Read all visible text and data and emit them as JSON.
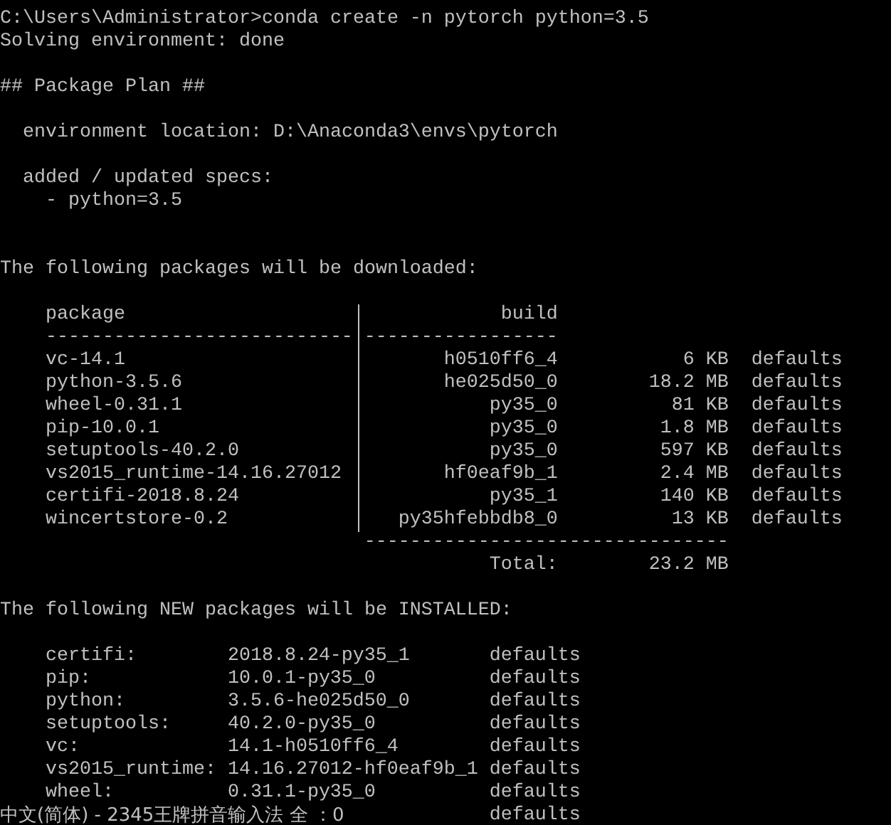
{
  "terminal": {
    "blocks": [
      {
        "kind": "text",
        "lines": [
          "C:\\Users\\Administrator>conda create -n pytorch python=3.5",
          "Solving environment: done"
        ]
      },
      {
        "kind": "blank"
      },
      {
        "kind": "text",
        "lines": [
          "## Package Plan ##"
        ]
      },
      {
        "kind": "blank"
      },
      {
        "kind": "text",
        "lines": [
          "  environment location: D:\\Anaconda3\\envs\\pytorch"
        ]
      },
      {
        "kind": "blank"
      },
      {
        "kind": "text",
        "lines": [
          "  added / updated specs:",
          "    - python=3.5"
        ]
      },
      {
        "kind": "blank"
      },
      {
        "kind": "blank"
      },
      {
        "kind": "text",
        "lines": [
          "The following packages will be downloaded:"
        ]
      },
      {
        "kind": "blank"
      },
      {
        "kind": "download_table",
        "columns": [
          "package",
          "build"
        ],
        "rule_left": "---------------------------",
        "rule_right": "-----------------",
        "rows": [
          {
            "package": "vc-14.1",
            "build": "h0510ff6_4",
            "size": "6 KB",
            "channel": "defaults"
          },
          {
            "package": "python-3.5.6",
            "build": "he025d50_0",
            "size": "18.2 MB",
            "channel": "defaults"
          },
          {
            "package": "wheel-0.31.1",
            "build": "py35_0",
            "size": "81 KB",
            "channel": "defaults"
          },
          {
            "package": "pip-10.0.1",
            "build": "py35_0",
            "size": "1.8 MB",
            "channel": "defaults"
          },
          {
            "package": "setuptools-40.2.0",
            "build": "py35_0",
            "size": "597 KB",
            "channel": "defaults"
          },
          {
            "package": "vs2015_runtime-14.16.27012",
            "build": "hf0eaf9b_1",
            "size": "2.4 MB",
            "channel": "defaults"
          },
          {
            "package": "certifi-2018.8.24",
            "build": "py35_1",
            "size": "140 KB",
            "channel": "defaults"
          },
          {
            "package": "wincertstore-0.2",
            "build": "py35hfebbdb8_0",
            "size": "13 KB",
            "channel": "defaults"
          }
        ],
        "total_rule": "--------------------------------",
        "total_label": "Total:",
        "total": "23.2 MB"
      },
      {
        "kind": "blank"
      },
      {
        "kind": "text",
        "lines": [
          "The following NEW packages will be INSTALLED:"
        ]
      },
      {
        "kind": "blank"
      },
      {
        "kind": "install_table",
        "rows": [
          {
            "name": "certifi:",
            "version": "2018.8.24-py35_1",
            "channel": "defaults"
          },
          {
            "name": "pip:",
            "version": "10.0.1-py35_0",
            "channel": "defaults"
          },
          {
            "name": "python:",
            "version": "3.5.6-he025d50_0",
            "channel": "defaults"
          },
          {
            "name": "setuptools:",
            "version": "40.2.0-py35_0",
            "channel": "defaults"
          },
          {
            "name": "vc:",
            "version": "14.1-h0510ff6_4",
            "channel": "defaults"
          },
          {
            "name": "vs2015_runtime:",
            "version": "14.16.27012-hf0eaf9b_1",
            "channel": "defaults"
          },
          {
            "name": "wheel:",
            "version": "0.31.1-py35_0",
            "channel": "defaults"
          },
          {
            "channel": "defaults"
          }
        ]
      }
    ]
  },
  "ime_status": "中文(简体) - 2345王牌拼音输入法 全 ：0"
}
